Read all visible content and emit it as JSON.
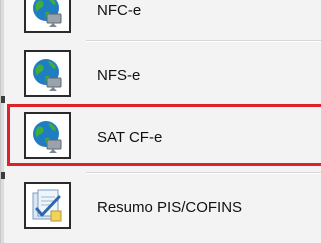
{
  "menu": {
    "items": [
      {
        "label": "NFC-e",
        "icon": "globe-network-icon"
      },
      {
        "label": "NFS-e",
        "icon": "globe-network-icon"
      },
      {
        "label": "SAT CF-e",
        "icon": "globe-network-icon",
        "highlighted": true
      },
      {
        "label": "Resumo PIS/COFINS",
        "icon": "documents-checkmark-icon"
      }
    ]
  },
  "colors": {
    "highlight_border": "#e0202a",
    "icon_frame_border": "#2b2b2b",
    "menu_background": "#f3f3f3"
  }
}
